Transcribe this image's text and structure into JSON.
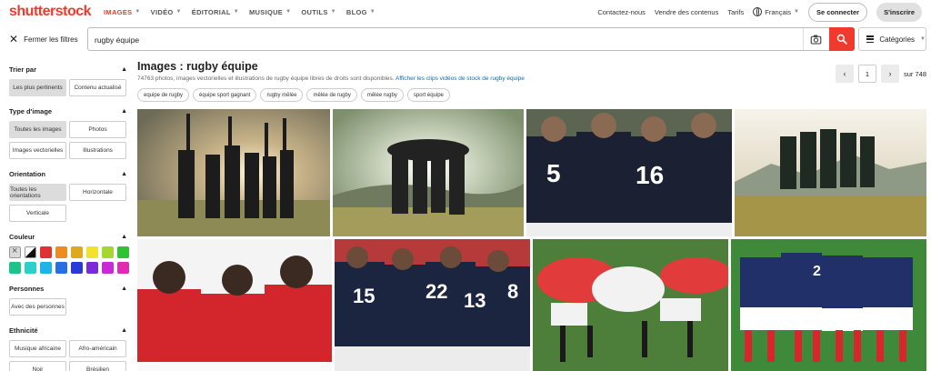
{
  "brand": {
    "logo": "shutterstock",
    "accent": "#ef3a2d"
  },
  "nav": {
    "links": [
      {
        "label": "IMAGES"
      },
      {
        "label": "VIDÉO"
      },
      {
        "label": "ÉDITORIAL"
      },
      {
        "label": "MUSIQUE"
      },
      {
        "label": "OUTILS"
      },
      {
        "label": "BLOG"
      }
    ],
    "contact": "Contactez-nous",
    "sell": "Vendre des contenus",
    "pricing": "Tarifs",
    "language": "Français",
    "login": "Se connecter",
    "signup": "S'inscrire"
  },
  "search": {
    "close_filters": "Fermer les filtres",
    "query": "rugby équipe",
    "categories": "Catégories"
  },
  "filters": {
    "sort": {
      "title": "Trier par",
      "options": [
        "Les plus pertinents",
        "Contenu actualisé"
      ]
    },
    "type": {
      "title": "Type d'image",
      "options": [
        "Toutes les images",
        "Photos",
        "Images vectorielles",
        "Illustrations"
      ]
    },
    "orientation": {
      "title": "Orientation",
      "options": [
        "Toutes les orientations",
        "Horizontale",
        "Verticale"
      ]
    },
    "color": {
      "title": "Couleur",
      "swatches": [
        "#d9d9d9",
        "bw",
        "#e03232",
        "#f08a1e",
        "#e0a81e",
        "#f2e22a",
        "#a6d630",
        "#30c230",
        "#1fc28a",
        "#2ad0c9",
        "#20b3e6",
        "#2a6fe0",
        "#2a3ad8",
        "#7a2ad6",
        "#c82ad6",
        "#e02ab0"
      ]
    },
    "people": {
      "title": "Personnes",
      "options": [
        "Avec des personnes"
      ]
    },
    "ethnicity": {
      "title": "Ethnicité",
      "options": [
        "Musique africaine",
        "Afro-américain",
        "Noir",
        "Brésilien"
      ]
    }
  },
  "results": {
    "title": "Images : rugby équipe",
    "subtitle": "74763 photos, images vectorielles et illustrations de rugby équipe libres de droits sont disponibles.",
    "link": "Afficher les clips vidéos de stock de rugby équipe",
    "tags": [
      "equipe de rugby",
      "équipe sport gagnant",
      "rugby mêlée",
      "mêlée de rugby",
      "mêlée rugby",
      "sport équipe"
    ],
    "page": "1",
    "total_pages": "sur 748"
  },
  "photos": [
    {
      "name": "team-celebration-sunset"
    },
    {
      "name": "team-huddle-sunlight"
    },
    {
      "name": "team-huddle-navy-jerseys"
    },
    {
      "name": "team-huddle-field-mountains"
    },
    {
      "name": "players-red-jerseys-embrace"
    },
    {
      "name": "navy-team-numbers-huddle"
    },
    {
      "name": "scrum-red-white"
    },
    {
      "name": "blue-team-huddle-field"
    }
  ]
}
